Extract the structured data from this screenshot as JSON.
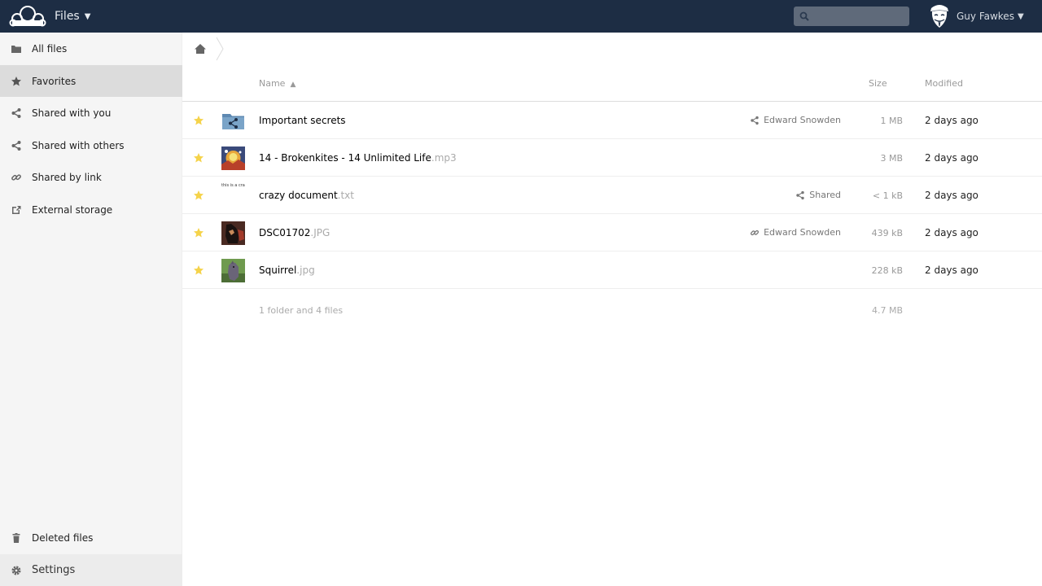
{
  "header": {
    "app_name": "Files",
    "search_placeholder": "",
    "user_name": "Guy Fawkes"
  },
  "sidebar": {
    "items": [
      {
        "label": "All files",
        "icon": "folder-icon"
      },
      {
        "label": "Favorites",
        "icon": "star-icon",
        "active": true
      },
      {
        "label": "Shared with you",
        "icon": "share-icon"
      },
      {
        "label": "Shared with others",
        "icon": "share-icon"
      },
      {
        "label": "Shared by link",
        "icon": "link-icon"
      },
      {
        "label": "External storage",
        "icon": "external-icon"
      }
    ],
    "deleted_label": "Deleted files",
    "settings_label": "Settings"
  },
  "columns": {
    "name": "Name",
    "sort_arrow": "▲",
    "size": "Size",
    "modified": "Modified"
  },
  "files": [
    {
      "base": "Important secrets",
      "ext": "",
      "share": "Edward Snowden",
      "share_icon": "share-icon",
      "size": "1 MB",
      "modified": "2 days ago",
      "thumb": "shared-folder"
    },
    {
      "base": "14 - Brokenkites - 14 Unlimited Life",
      "ext": ".mp3",
      "share": "",
      "share_icon": "",
      "size": "3 MB",
      "modified": "2 days ago",
      "thumb": "album-art"
    },
    {
      "base": "crazy document",
      "ext": ".txt",
      "share": "Shared",
      "share_icon": "share-icon",
      "size": "< 1 kB",
      "modified": "2 days ago",
      "thumb": "text-preview",
      "thumb_text": "this is a cra"
    },
    {
      "base": "DSC01702",
      "ext": ".JPG",
      "share": "Edward Snowden",
      "share_icon": "link-icon",
      "size": "439 kB",
      "modified": "2 days ago",
      "thumb": "photo-dog"
    },
    {
      "base": "Squirrel",
      "ext": ".jpg",
      "share": "",
      "share_icon": "",
      "size": "228 kB",
      "modified": "2 days ago",
      "thumb": "photo-squirrel"
    }
  ],
  "summary": {
    "text": "1 folder and 4 files",
    "size": "4.7 MB"
  },
  "colors": {
    "header_bg": "#1d2d44",
    "star_fill": "#f5d34a",
    "active_nav": "#dcdcdc"
  }
}
